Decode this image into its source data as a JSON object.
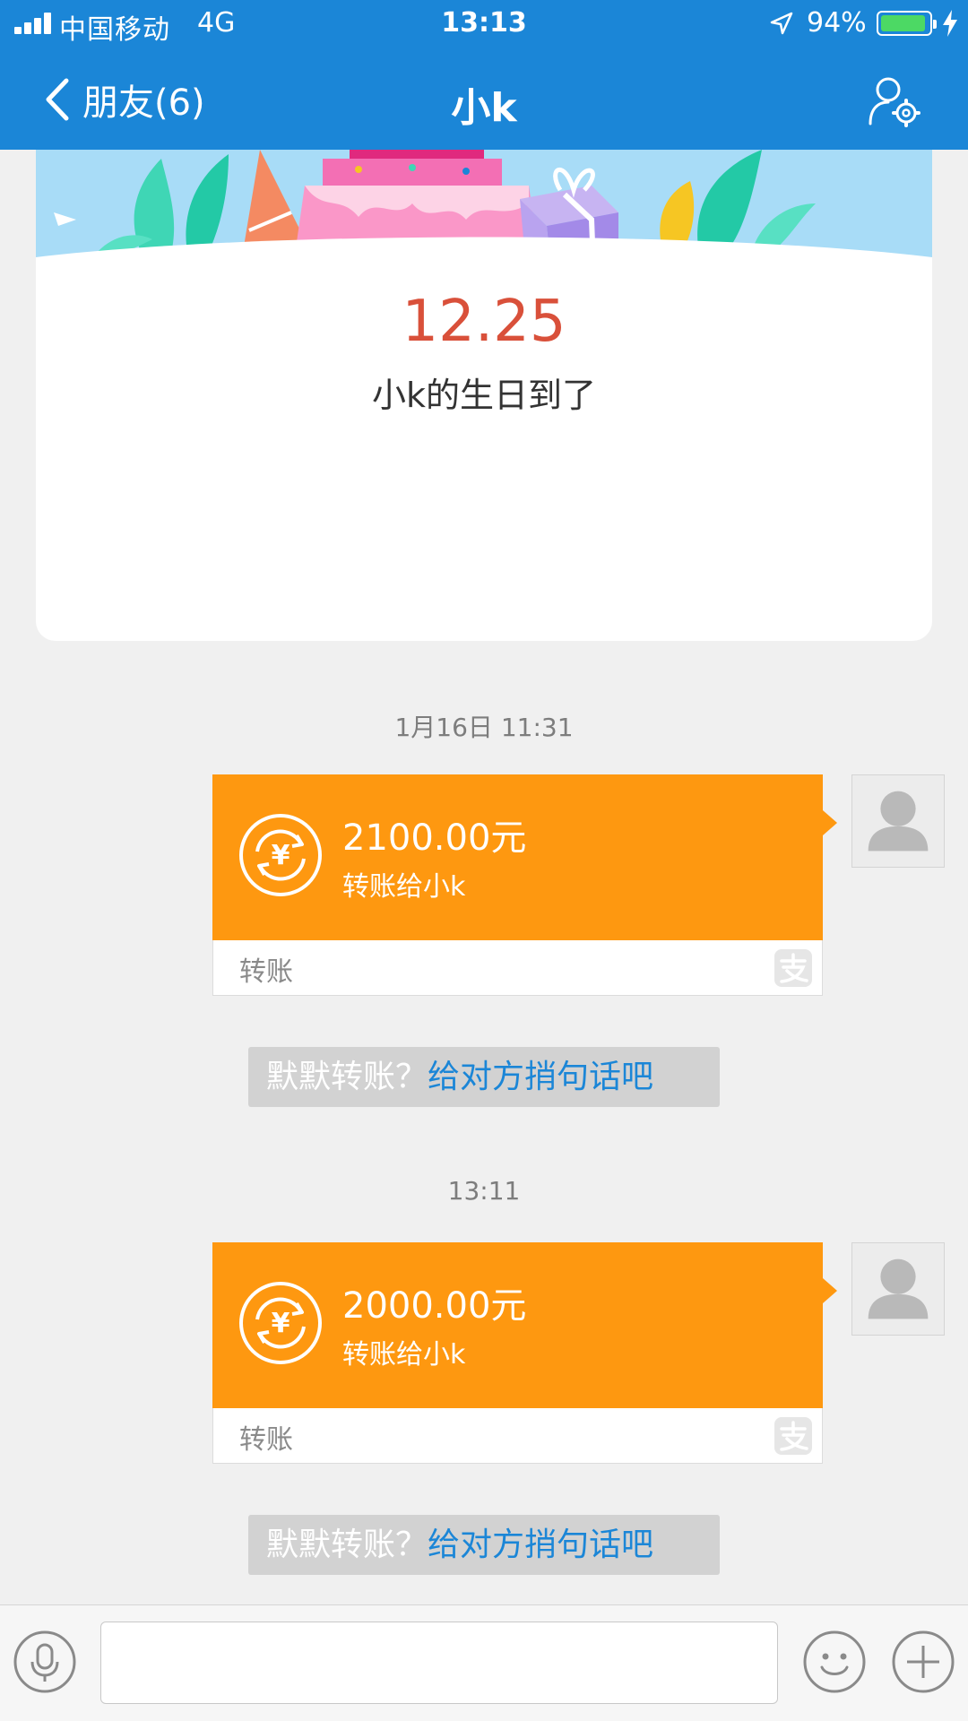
{
  "status_bar": {
    "carrier": "中国移动",
    "network": "4G",
    "time": "13:13",
    "battery_percent": "94%",
    "battery_level": 0.94
  },
  "nav": {
    "back_label": "朋友(6)",
    "title": "小k"
  },
  "birthday_card": {
    "date": "12.25",
    "text": "小k的生日到了"
  },
  "messages": [
    {
      "timestamp": "1月16日 11:31",
      "amount": "2100.00元",
      "description": "转账给小k",
      "type_label": "转账",
      "prompt_text": "默默转账？",
      "prompt_link": "给对方捎句话吧"
    },
    {
      "timestamp": "13:11",
      "amount": "2000.00元",
      "description": "转账给小k",
      "type_label": "转账",
      "prompt_text": "默默转账？",
      "prompt_link": "给对方捎句话吧"
    }
  ],
  "colors": {
    "brand_blue": "#1b86d7",
    "transfer_orange": "#fe9810",
    "birthday_red": "#d9503a"
  },
  "icons": {
    "back": "chevron-left-icon",
    "settings": "profile-settings-icon",
    "coin": "yen-exchange-icon",
    "alipay": "alipay-icon",
    "voice": "microphone-icon",
    "emoji": "smiley-icon",
    "plus": "plus-icon"
  }
}
